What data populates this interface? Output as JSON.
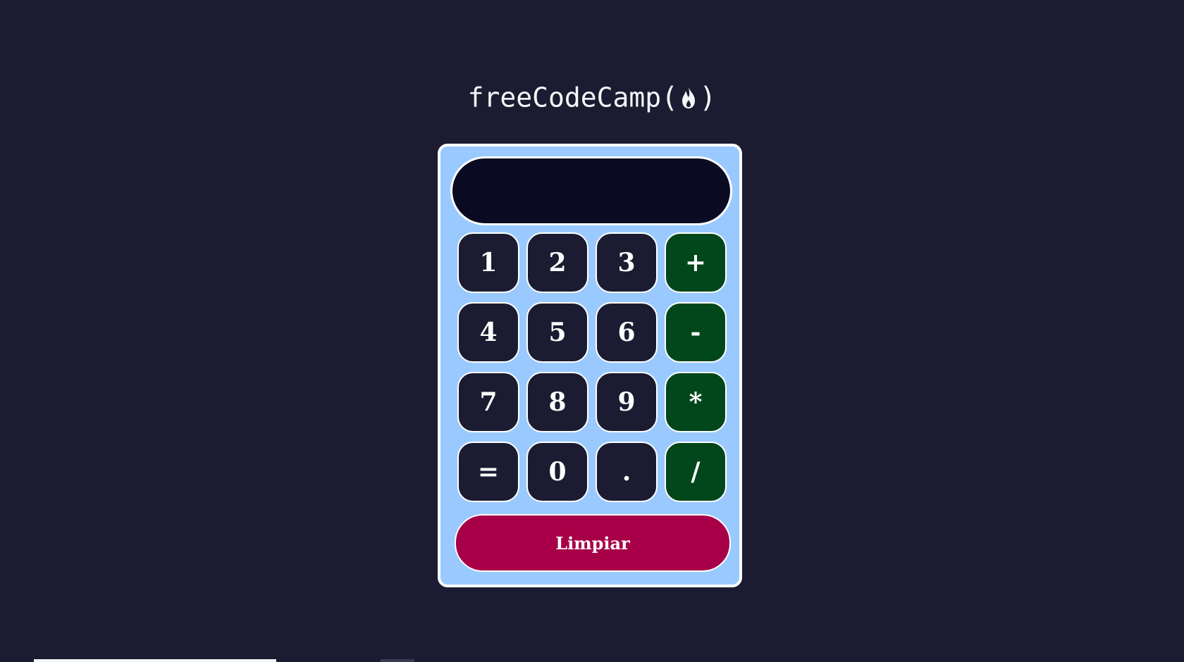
{
  "header": {
    "brand_text": "freeCodeCamp",
    "paren_open": "(",
    "paren_close": ")",
    "flame_icon": "flame-icon"
  },
  "calculator": {
    "display_value": "",
    "keys": [
      {
        "label": "1",
        "kind": "digit"
      },
      {
        "label": "2",
        "kind": "digit"
      },
      {
        "label": "3",
        "kind": "digit"
      },
      {
        "label": "+",
        "kind": "operator"
      },
      {
        "label": "4",
        "kind": "digit"
      },
      {
        "label": "5",
        "kind": "digit"
      },
      {
        "label": "6",
        "kind": "digit"
      },
      {
        "label": "-",
        "kind": "operator"
      },
      {
        "label": "7",
        "kind": "digit"
      },
      {
        "label": "8",
        "kind": "digit"
      },
      {
        "label": "9",
        "kind": "digit"
      },
      {
        "label": "*",
        "kind": "operator"
      },
      {
        "label": "=",
        "kind": "equals"
      },
      {
        "label": "0",
        "kind": "digit"
      },
      {
        "label": ".",
        "kind": "decimal"
      },
      {
        "label": "/",
        "kind": "operator"
      }
    ],
    "clear_label": "Limpiar"
  },
  "colors": {
    "page_background": "#1b1b32",
    "calculator_body": "#99c9ff",
    "display_background": "#0a0a23",
    "digit_key": "#1b1b32",
    "operator_key": "#00471b",
    "clear_button": "#a80048",
    "text": "#ffffff"
  }
}
